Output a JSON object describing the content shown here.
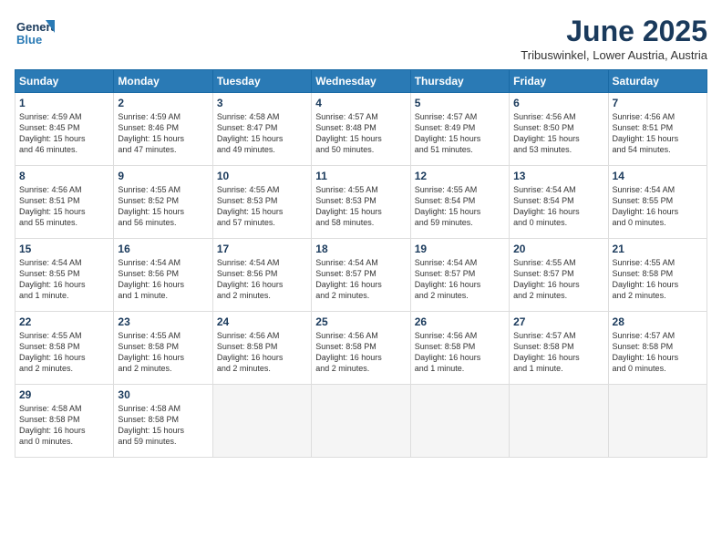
{
  "logo": {
    "line1": "General",
    "line2": "Blue"
  },
  "title": "June 2025",
  "location": "Tribuswinkel, Lower Austria, Austria",
  "weekdays": [
    "Sunday",
    "Monday",
    "Tuesday",
    "Wednesday",
    "Thursday",
    "Friday",
    "Saturday"
  ],
  "weeks": [
    [
      {
        "day": "1",
        "info": "Sunrise: 4:59 AM\nSunset: 8:45 PM\nDaylight: 15 hours\nand 46 minutes."
      },
      {
        "day": "2",
        "info": "Sunrise: 4:59 AM\nSunset: 8:46 PM\nDaylight: 15 hours\nand 47 minutes."
      },
      {
        "day": "3",
        "info": "Sunrise: 4:58 AM\nSunset: 8:47 PM\nDaylight: 15 hours\nand 49 minutes."
      },
      {
        "day": "4",
        "info": "Sunrise: 4:57 AM\nSunset: 8:48 PM\nDaylight: 15 hours\nand 50 minutes."
      },
      {
        "day": "5",
        "info": "Sunrise: 4:57 AM\nSunset: 8:49 PM\nDaylight: 15 hours\nand 51 minutes."
      },
      {
        "day": "6",
        "info": "Sunrise: 4:56 AM\nSunset: 8:50 PM\nDaylight: 15 hours\nand 53 minutes."
      },
      {
        "day": "7",
        "info": "Sunrise: 4:56 AM\nSunset: 8:51 PM\nDaylight: 15 hours\nand 54 minutes."
      }
    ],
    [
      {
        "day": "8",
        "info": "Sunrise: 4:56 AM\nSunset: 8:51 PM\nDaylight: 15 hours\nand 55 minutes."
      },
      {
        "day": "9",
        "info": "Sunrise: 4:55 AM\nSunset: 8:52 PM\nDaylight: 15 hours\nand 56 minutes."
      },
      {
        "day": "10",
        "info": "Sunrise: 4:55 AM\nSunset: 8:53 PM\nDaylight: 15 hours\nand 57 minutes."
      },
      {
        "day": "11",
        "info": "Sunrise: 4:55 AM\nSunset: 8:53 PM\nDaylight: 15 hours\nand 58 minutes."
      },
      {
        "day": "12",
        "info": "Sunrise: 4:55 AM\nSunset: 8:54 PM\nDaylight: 15 hours\nand 59 minutes."
      },
      {
        "day": "13",
        "info": "Sunrise: 4:54 AM\nSunset: 8:54 PM\nDaylight: 16 hours\nand 0 minutes."
      },
      {
        "day": "14",
        "info": "Sunrise: 4:54 AM\nSunset: 8:55 PM\nDaylight: 16 hours\nand 0 minutes."
      }
    ],
    [
      {
        "day": "15",
        "info": "Sunrise: 4:54 AM\nSunset: 8:55 PM\nDaylight: 16 hours\nand 1 minute."
      },
      {
        "day": "16",
        "info": "Sunrise: 4:54 AM\nSunset: 8:56 PM\nDaylight: 16 hours\nand 1 minute."
      },
      {
        "day": "17",
        "info": "Sunrise: 4:54 AM\nSunset: 8:56 PM\nDaylight: 16 hours\nand 2 minutes."
      },
      {
        "day": "18",
        "info": "Sunrise: 4:54 AM\nSunset: 8:57 PM\nDaylight: 16 hours\nand 2 minutes."
      },
      {
        "day": "19",
        "info": "Sunrise: 4:54 AM\nSunset: 8:57 PM\nDaylight: 16 hours\nand 2 minutes."
      },
      {
        "day": "20",
        "info": "Sunrise: 4:55 AM\nSunset: 8:57 PM\nDaylight: 16 hours\nand 2 minutes."
      },
      {
        "day": "21",
        "info": "Sunrise: 4:55 AM\nSunset: 8:58 PM\nDaylight: 16 hours\nand 2 minutes."
      }
    ],
    [
      {
        "day": "22",
        "info": "Sunrise: 4:55 AM\nSunset: 8:58 PM\nDaylight: 16 hours\nand 2 minutes."
      },
      {
        "day": "23",
        "info": "Sunrise: 4:55 AM\nSunset: 8:58 PM\nDaylight: 16 hours\nand 2 minutes."
      },
      {
        "day": "24",
        "info": "Sunrise: 4:56 AM\nSunset: 8:58 PM\nDaylight: 16 hours\nand 2 minutes."
      },
      {
        "day": "25",
        "info": "Sunrise: 4:56 AM\nSunset: 8:58 PM\nDaylight: 16 hours\nand 2 minutes."
      },
      {
        "day": "26",
        "info": "Sunrise: 4:56 AM\nSunset: 8:58 PM\nDaylight: 16 hours\nand 1 minute."
      },
      {
        "day": "27",
        "info": "Sunrise: 4:57 AM\nSunset: 8:58 PM\nDaylight: 16 hours\nand 1 minute."
      },
      {
        "day": "28",
        "info": "Sunrise: 4:57 AM\nSunset: 8:58 PM\nDaylight: 16 hours\nand 0 minutes."
      }
    ],
    [
      {
        "day": "29",
        "info": "Sunrise: 4:58 AM\nSunset: 8:58 PM\nDaylight: 16 hours\nand 0 minutes."
      },
      {
        "day": "30",
        "info": "Sunrise: 4:58 AM\nSunset: 8:58 PM\nDaylight: 15 hours\nand 59 minutes."
      },
      {
        "day": "",
        "info": ""
      },
      {
        "day": "",
        "info": ""
      },
      {
        "day": "",
        "info": ""
      },
      {
        "day": "",
        "info": ""
      },
      {
        "day": "",
        "info": ""
      }
    ]
  ]
}
